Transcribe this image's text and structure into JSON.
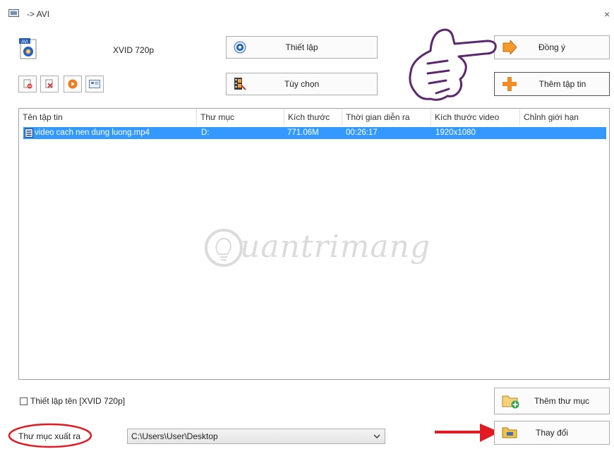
{
  "window": {
    "title": "-> AVI",
    "close_symbol": "×"
  },
  "format": {
    "label": "XVID 720p",
    "icon": "avi-file-icon"
  },
  "buttons": {
    "settings": "Thiết lập",
    "options": "Tùy chọn",
    "ok": "Đồng ý",
    "add_file": "Thêm tập tin",
    "add_folder": "Thêm thư mục",
    "change": "Thay đổi"
  },
  "toolbar_icons": [
    "remove-file-icon",
    "clear-list-icon",
    "play-icon",
    "media-info-icon"
  ],
  "table": {
    "columns": [
      "Tên tập tin",
      "Thư mục",
      "Kích thước",
      "Thời gian diễn ra",
      "Kích thước video",
      "Chỉnh giới hạn"
    ],
    "rows": [
      {
        "name": "video cach nen dung luong.mp4",
        "folder": "D:",
        "size": "771.06M",
        "duration": "00:26:17",
        "video_size": "1920x1080",
        "limit": ""
      }
    ]
  },
  "watermark": {
    "text": "uantrimang"
  },
  "output": {
    "set_name_label": "Thiết lập tên [XVID 720p]",
    "set_name_checked": false,
    "folder_label": "Thư mục xuất ra",
    "path": "C:\\Users\\User\\Desktop"
  },
  "colors": {
    "selection": "#3399ff",
    "annotation_red": "#e01b24",
    "hand_purple": "#5b2a6e"
  }
}
